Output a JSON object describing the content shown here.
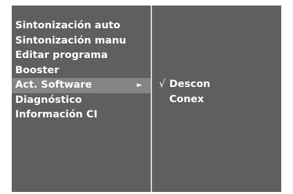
{
  "menu": {
    "items": [
      {
        "label": "Sintonización auto"
      },
      {
        "label": "Sintonización manu"
      },
      {
        "label": "Editar programa"
      },
      {
        "label": "Booster"
      },
      {
        "label": "Act. Software",
        "selected": true,
        "arrow": "►"
      },
      {
        "label": "Diagnóstico"
      },
      {
        "label": "Información CI"
      }
    ]
  },
  "submenu": {
    "options": [
      {
        "check": "√",
        "label": "Descon"
      },
      {
        "check": "",
        "label": "Conex"
      }
    ]
  },
  "colors": {
    "panel": "#5f5f5f",
    "highlight": "#858585",
    "divider": "#d8d8d8",
    "text": "#ffffff"
  }
}
